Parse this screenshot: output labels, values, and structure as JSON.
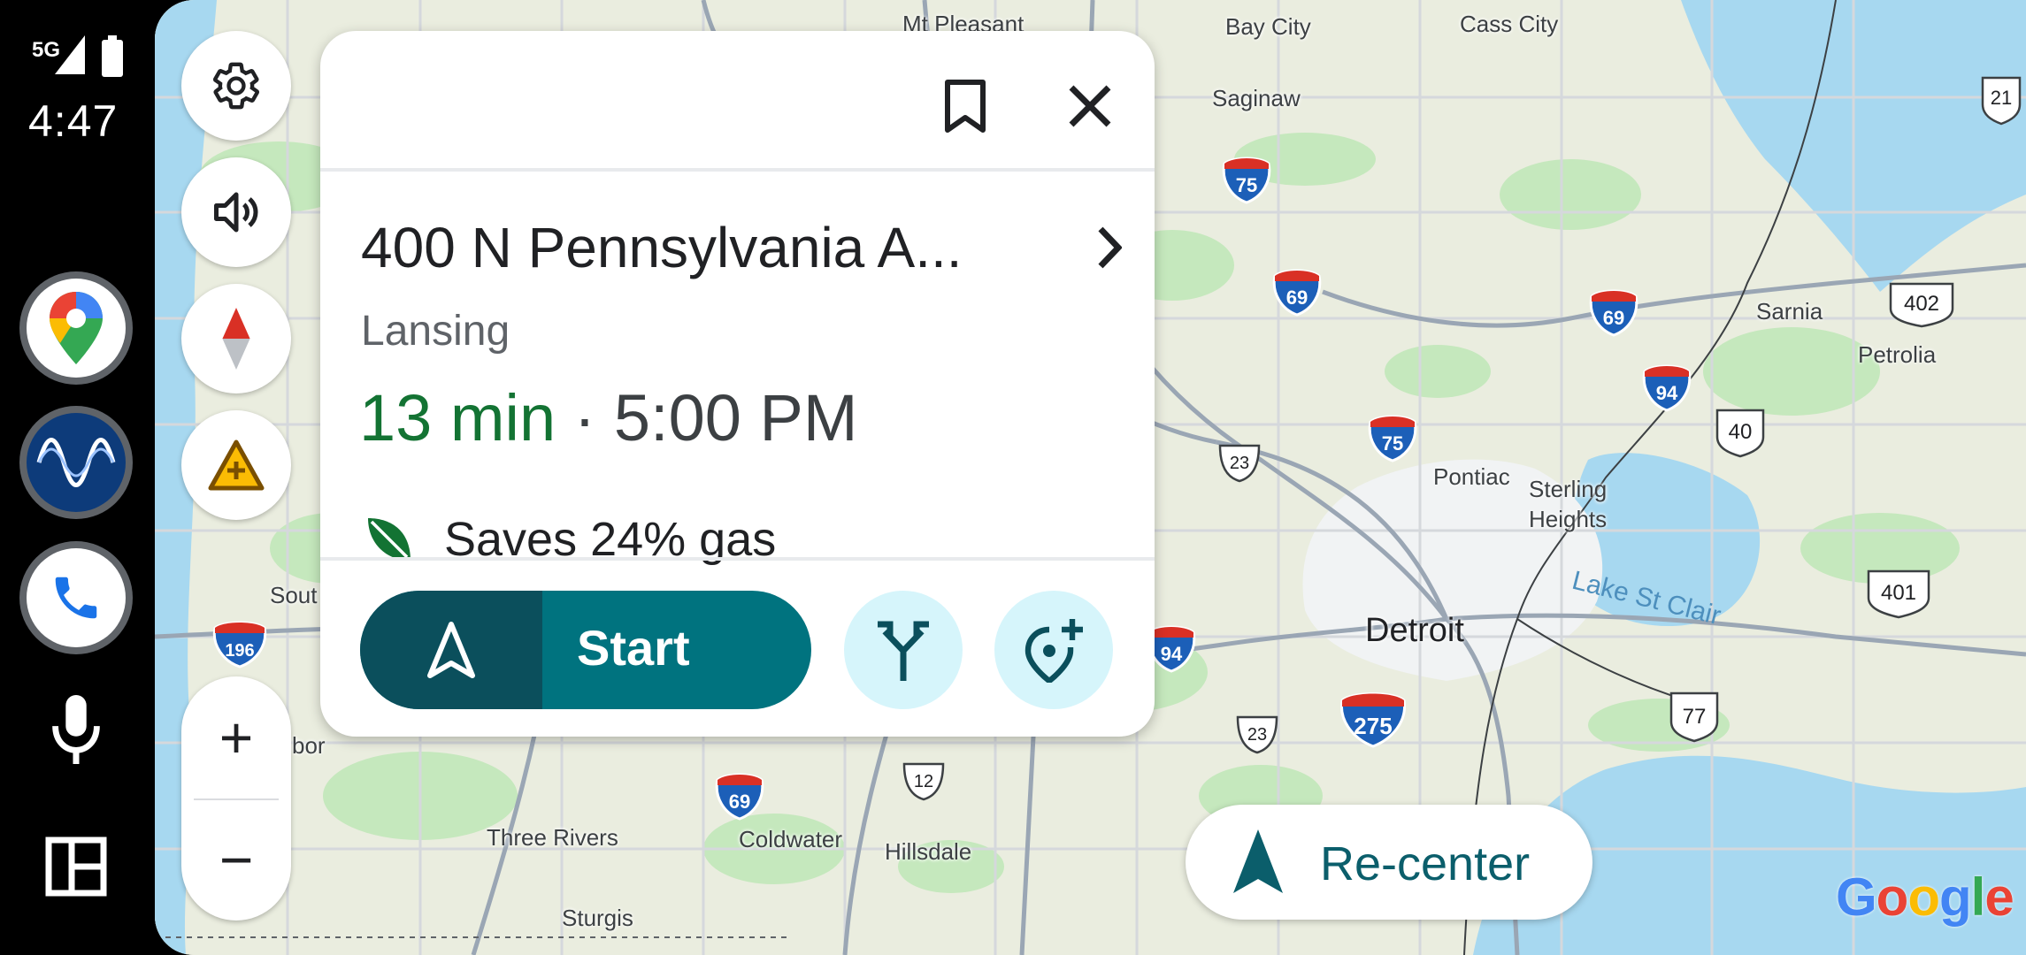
{
  "status_bar": {
    "network": "5G",
    "time": "4:47"
  },
  "rail": {
    "apps": [
      {
        "name": "Google Maps",
        "icon": "maps-pin-icon"
      },
      {
        "name": "Waves app",
        "icon": "wave-icon"
      },
      {
        "name": "Phone",
        "icon": "phone-icon"
      }
    ],
    "mic_icon": "microphone-icon",
    "dashboard_icon": "dashboard-grid-icon"
  },
  "map_controls": {
    "settings_icon": "gear-icon",
    "sound_icon": "speaker-icon",
    "compass_icon": "compass-icon",
    "report_icon": "report-incident-icon",
    "zoom_in": "+",
    "zoom_out": "−"
  },
  "card": {
    "address": "400 N Pennsylvania A...",
    "city": "Lansing",
    "duration": "13 min",
    "separator": "·",
    "arrival": "5:00 PM",
    "eco_text": "Saves 24% gas",
    "start_label": "Start",
    "bookmark_icon": "bookmark-icon",
    "close_icon": "close-icon",
    "routes_icon": "alternate-routes-icon",
    "add_stop_icon": "add-stop-icon"
  },
  "recenter_label": "Re-center",
  "google_logo": [
    "G",
    "o",
    "o",
    "g",
    "l",
    "e"
  ],
  "map_labels": {
    "mt_pleasant": "Mt Pleasant",
    "bay_city": "Bay City",
    "cass_city": "Cass City",
    "saginaw": "Saginaw",
    "sarnia": "Sarnia",
    "petrolia": "Petrolia",
    "pontiac": "Pontiac",
    "sterling": "Sterling",
    "heights": "Heights",
    "detroit": "Detroit",
    "lake_st_clair": "Lake St Clair",
    "south_haven": "Sout",
    "harbor": "bor",
    "three_rivers": "Three Rivers",
    "coldwater": "Coldwater",
    "hillsdale": "Hillsdale",
    "sturgis": "Sturgis"
  },
  "shields": {
    "i75a": "75",
    "i69a": "69",
    "i69b": "69",
    "i94a": "94",
    "i75b": "75",
    "i196": "196",
    "i94b": "94",
    "i275": "275",
    "i69c": "69",
    "us23a": "23",
    "us23b": "23",
    "us12": "12",
    "on21": "21",
    "on402": "402",
    "on40": "40",
    "on401": "401",
    "on77": "77"
  },
  "colors": {
    "eta_green": "#137333",
    "start_dark": "#0b4f5c",
    "start_teal": "#00737f",
    "recenter_teal": "#0b5e6b",
    "water": "#a7d8f0",
    "park_green": "#b8e2b0"
  }
}
